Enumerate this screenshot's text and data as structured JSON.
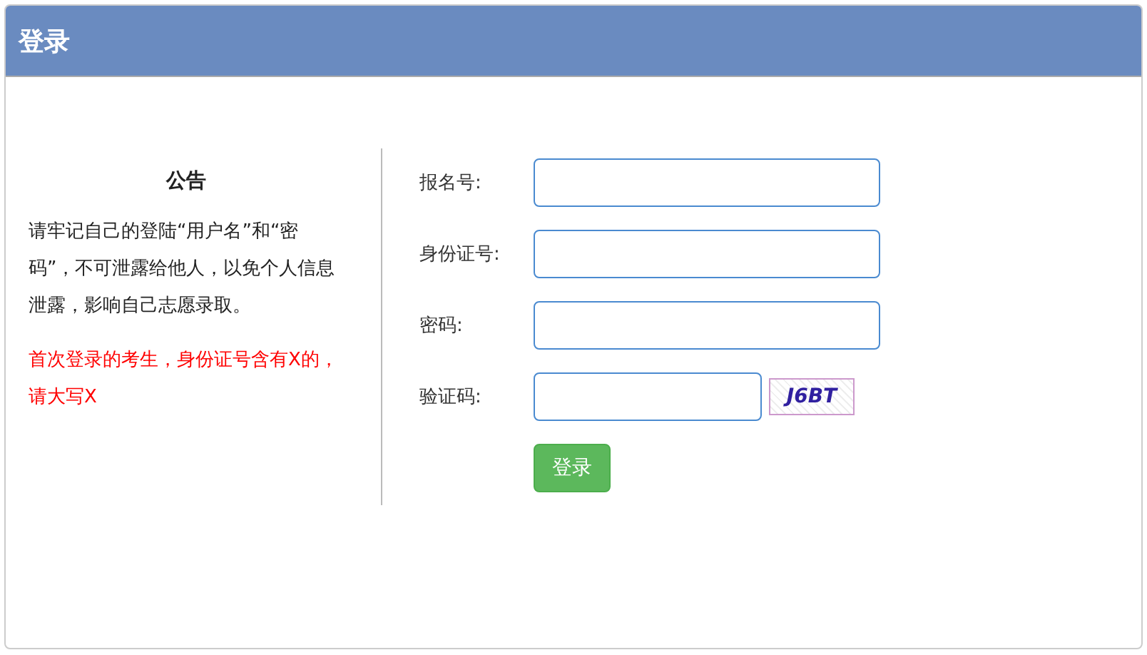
{
  "panel": {
    "title": "登录"
  },
  "notice": {
    "title": "公告",
    "paragraphs": [
      {
        "text": "请牢记自己的登陆“用户名”和“密码”，不可泄露给他人，以免个人信息泄露，影响自己志愿录取。",
        "kind": "normal"
      },
      {
        "text": "首次登录的考生，身份证号含有X的，请大写X",
        "kind": "warning"
      }
    ]
  },
  "form": {
    "fields": [
      {
        "label": "报名号:",
        "kind": "text"
      },
      {
        "label": "身份证号:",
        "kind": "text"
      },
      {
        "label": "密码:",
        "kind": "password"
      },
      {
        "label": "验证码:",
        "kind": "captcha",
        "captcha": "J6BT"
      }
    ],
    "submit": "登录"
  }
}
